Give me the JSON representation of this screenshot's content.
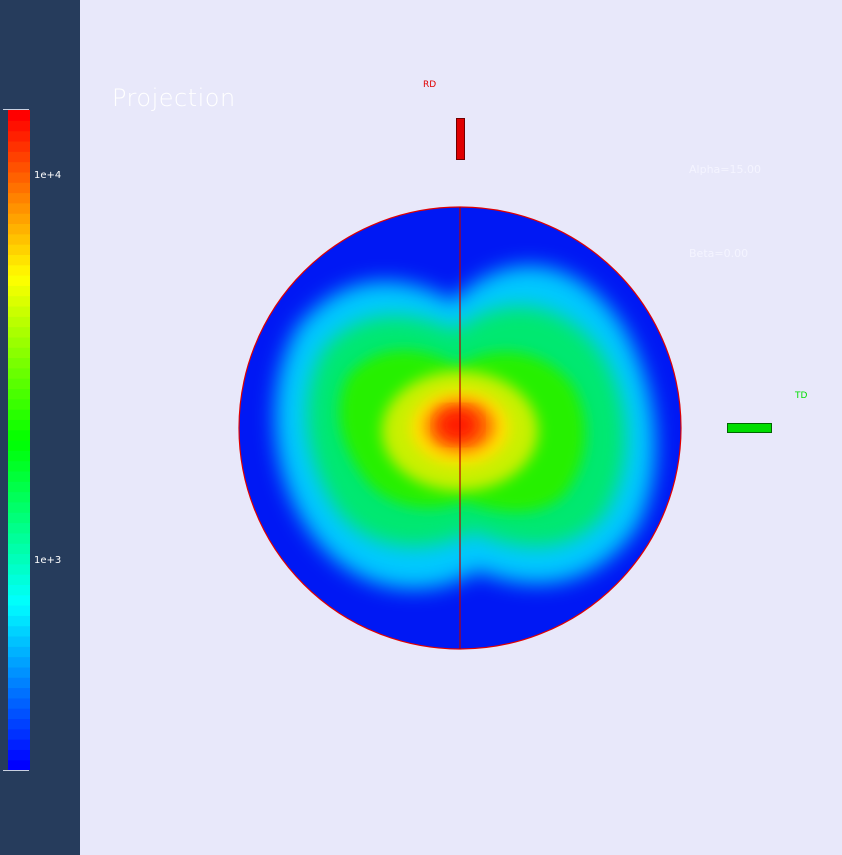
{
  "viewport": {
    "title": "Projection",
    "alpha_label": "Alpha=15.00",
    "beta_label": "Beta=0.00"
  },
  "axes": {
    "rd_label": "RD",
    "td_label": "TD",
    "rd_color": "#e00000",
    "td_color": "#00dd00"
  },
  "colorbar": {
    "scale": "log",
    "range": [
      200,
      20000
    ],
    "ticks": [
      {
        "value": 10000,
        "label": "1e+4"
      },
      {
        "value": 1000,
        "label": "1e+3"
      }
    ],
    "colors": [
      "#0000ff",
      "#00ffff",
      "#00ff00",
      "#ffff00",
      "#ff0000"
    ],
    "steps": 64
  },
  "pole_figure": {
    "outline_color": "#e00000",
    "center_value_level": "max"
  }
}
